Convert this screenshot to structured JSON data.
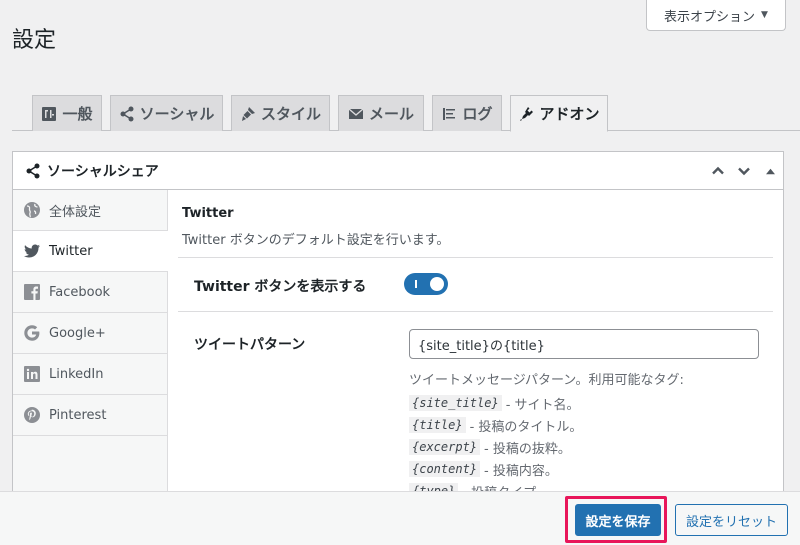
{
  "page": {
    "title": "設定"
  },
  "screen_options": {
    "label": "表示オプション"
  },
  "tabs": [
    {
      "label": "一般",
      "icon": "general-icon"
    },
    {
      "label": "ソーシャル",
      "icon": "share-icon"
    },
    {
      "label": "スタイル",
      "icon": "brush-icon"
    },
    {
      "label": "メール",
      "icon": "email-icon"
    },
    {
      "label": "ログ",
      "icon": "list-icon"
    },
    {
      "label": "アドオン",
      "icon": "plugin-icon",
      "active": true
    }
  ],
  "panel": {
    "title": "ソーシャルシェア"
  },
  "sidenav": [
    {
      "label": "全体設定",
      "icon": "globe-icon"
    },
    {
      "label": "Twitter",
      "icon": "twitter-icon",
      "active": true
    },
    {
      "label": "Facebook",
      "icon": "facebook-icon"
    },
    {
      "label": "Google+",
      "icon": "google-icon"
    },
    {
      "label": "LinkedIn",
      "icon": "linkedin-icon"
    },
    {
      "label": "Pinterest",
      "icon": "pinterest-icon"
    }
  ],
  "content": {
    "title": "Twitter",
    "description": "Twitter ボタンのデフォルト設定を行います。",
    "show_button": {
      "label": "Twitter ボタンを表示する",
      "enabled": true
    },
    "tweet_pattern": {
      "label": "ツイートパターン",
      "value": "{site_title}の{title}",
      "help": "ツイートメッセージパターン。利用可能なタグ:",
      "tags": [
        {
          "code": "{site_title}",
          "desc": "- サイト名。"
        },
        {
          "code": "{title}",
          "desc": "- 投稿のタイトル。"
        },
        {
          "code": "{excerpt}",
          "desc": "- 投稿の抜粋。"
        },
        {
          "code": "{content}",
          "desc": "- 投稿内容。"
        },
        {
          "code": "{type}",
          "desc": "- 投稿タイプ。"
        }
      ]
    }
  },
  "footer": {
    "save_label": "設定を保存",
    "reset_label": "設定をリセット"
  },
  "colors": {
    "accent": "#2271b1",
    "highlight": "#e8165a"
  }
}
